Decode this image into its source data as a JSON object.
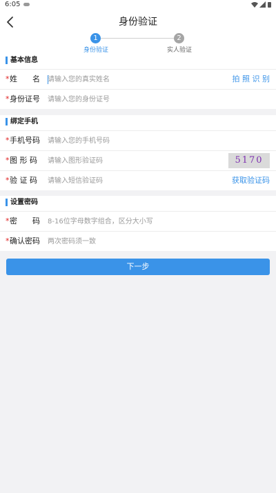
{
  "status_bar": {
    "time": "6:05"
  },
  "header": {
    "title": "身份验证"
  },
  "steps": [
    {
      "number": "1",
      "label": "身份验证",
      "active": true
    },
    {
      "number": "2",
      "label": "实人验证",
      "active": false
    }
  ],
  "sections": {
    "basic": {
      "title": "基本信息",
      "name_label": "姓　　名",
      "name_placeholder": "请输入您的真实姓名",
      "photo_action": "拍 照 识 别",
      "id_label": "身份证号",
      "id_placeholder": "请输入您的身份证号"
    },
    "phone": {
      "title": "绑定手机",
      "phone_label": "手机号码",
      "phone_placeholder": "请输入您的手机号码",
      "captcha_label": "图 形 码",
      "captcha_placeholder": "请输入图形验证码",
      "captcha_text": "5170",
      "sms_label": "验 证 码",
      "sms_placeholder": "请输入短信验证码",
      "sms_action": "获取验证码"
    },
    "password": {
      "title": "设置密码",
      "pwd_label": "密　　码",
      "pwd_placeholder": "8-16位字母数字组合，区分大小写",
      "confirm_label": "确认密码",
      "confirm_placeholder": "两次密码须一致"
    }
  },
  "required_mark": "*",
  "next_button": "下一步",
  "colors": {
    "accent": "#3a93e8",
    "required": "#e02020",
    "captcha_text": "#7d2fb0"
  }
}
